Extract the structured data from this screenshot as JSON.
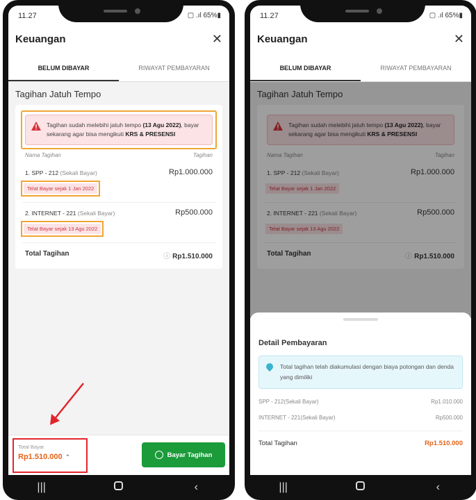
{
  "status": {
    "time": "11.27",
    "signal": "▢ .ıl 65%▮"
  },
  "app": {
    "title": "Keuangan",
    "close_icon": "close-icon"
  },
  "tabs": [
    {
      "label": "BELUM DIBAYAR",
      "active": true
    },
    {
      "label": "RIWAYAT PEMBAYARAN",
      "active": false
    }
  ],
  "section_title": "Tagihan Jatuh Tempo",
  "alert": {
    "text_pre": "Tagihan sudah melebihi jatuh tempo ",
    "date": "(13 Agu 2022)",
    "text_mid": ", bayar sekarang agar bisa mengikuti ",
    "subject": "KRS & PRESENSI"
  },
  "columns": {
    "name": "Nama Tagihan",
    "amount": "Tagihan"
  },
  "items": [
    {
      "name": "1. SPP - 212 ",
      "sub": "(Sekali Bayar)",
      "amount": "Rp1.000.000",
      "late": "Telat Bayar sejak 1 Jan 2022"
    },
    {
      "name": "2. INTERNET - 221 ",
      "sub": "(Sekali Bayar)",
      "amount": "Rp500.000",
      "late": "Telat Bayar sejak 13 Agu 2022"
    }
  ],
  "total": {
    "label": "Total Tagihan",
    "amount": "Rp1.510.000"
  },
  "bottom": {
    "total_label": "Total Bayar",
    "total_value": "Rp1.510.000",
    "pay_button": "Bayar Tagihan"
  },
  "sheet": {
    "title": "Detail Pembayaran",
    "info": "Total tagihan telah diakumulasi dengan biaya potongan dan denda yang dimiliki",
    "rows": [
      {
        "label": "SPP - 212(Sekali Bayar)",
        "amount": "Rp1.010.000"
      },
      {
        "label": "INTERNET - 221(Sekali Bayar)",
        "amount": "Rp500.000"
      }
    ],
    "total_label": "Total Tagihan",
    "total_amount": "Rp1.510.000"
  },
  "colors": {
    "primary_green": "#1b9b3a",
    "accent_orange": "#e2631a",
    "highlight_border": "#f0a531",
    "error_red": "#e2252c"
  }
}
